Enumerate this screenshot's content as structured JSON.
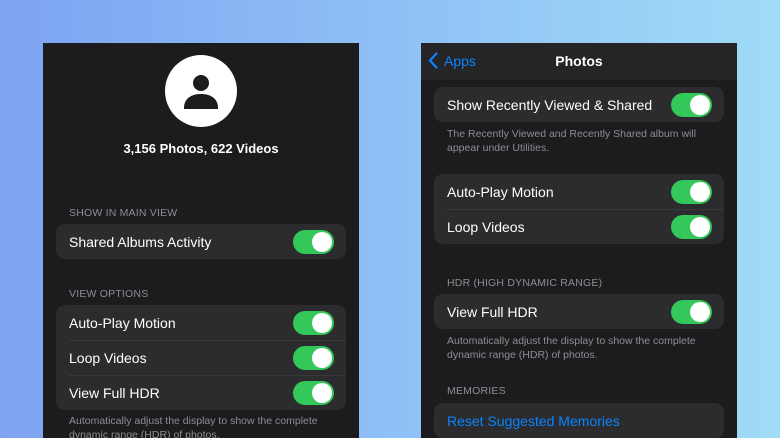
{
  "left": {
    "counts": "3,156 Photos, 622 Videos",
    "section_main_view": "SHOW IN MAIN VIEW",
    "shared_albums_activity": "Shared Albums Activity",
    "section_view_options": "VIEW OPTIONS",
    "auto_play_motion": "Auto-Play Motion",
    "loop_videos": "Loop Videos",
    "view_full_hdr": "View Full HDR",
    "hdr_footnote": "Automatically adjust the display to show the complete dynamic range (HDR) of photos."
  },
  "right": {
    "back_label": "Apps",
    "title": "Photos",
    "show_recently_viewed": "Show Recently Viewed & Shared",
    "recently_footnote": "The Recently Viewed and Recently Shared album will appear under Utilities.",
    "auto_play_motion": "Auto-Play Motion",
    "loop_videos": "Loop Videos",
    "section_hdr": "HDR (HIGH DYNAMIC RANGE)",
    "view_full_hdr": "View Full HDR",
    "hdr_footnote": "Automatically adjust the display to show the complete dynamic range (HDR) of photos.",
    "section_memories": "MEMORIES",
    "reset_memories": "Reset Suggested Memories"
  },
  "toggles": {
    "left_shared_albums_activity": "on",
    "left_auto_play_motion": "on",
    "left_loop_videos": "on",
    "left_view_full_hdr": "on",
    "right_show_recently_viewed": "on",
    "right_auto_play_motion": "on",
    "right_loop_videos": "on",
    "right_view_full_hdr": "on"
  },
  "colors": {
    "toggle_on": "#34c759",
    "link_blue": "#0a84ff",
    "panel_bg": "#1c1c1e",
    "group_bg": "#2c2c2e"
  },
  "icons": {
    "avatar": "person-icon",
    "back": "chevron-left-icon"
  }
}
